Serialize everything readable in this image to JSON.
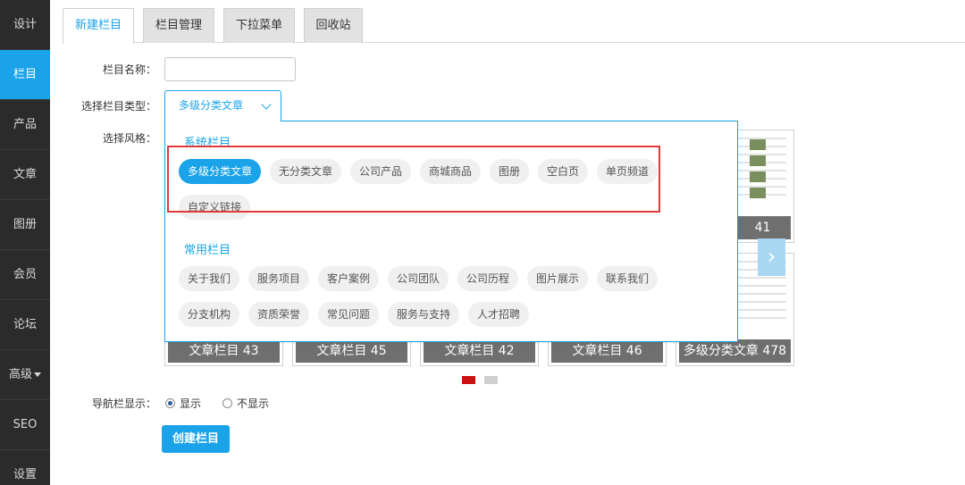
{
  "sidebar": {
    "items": [
      {
        "label": "设计"
      },
      {
        "label": "栏目"
      },
      {
        "label": "产品"
      },
      {
        "label": "文章"
      },
      {
        "label": "图册"
      },
      {
        "label": "会员"
      },
      {
        "label": "论坛"
      },
      {
        "label": "高级"
      },
      {
        "label": "SEO"
      },
      {
        "label": "设置"
      }
    ],
    "active_index": 1
  },
  "tabs": [
    {
      "label": "新建栏目"
    },
    {
      "label": "栏目管理"
    },
    {
      "label": "下拉菜单"
    },
    {
      "label": "回收站"
    }
  ],
  "form": {
    "name_label": "栏目名称：",
    "name_value": "",
    "type_label": "选择栏目类型：",
    "type_value": "多级分类文章",
    "style_label": "选择风格：",
    "nav_label": "导航栏显示：",
    "nav_options": [
      "显示",
      "不显示"
    ],
    "nav_selected": "显示",
    "create_button": "创建栏目"
  },
  "dropdown": {
    "system_title": "系统栏目",
    "system_items": [
      "多级分类文章",
      "无分类文章",
      "公司产品",
      "商城商品",
      "图册",
      "空白页",
      "单页频道",
      "自定义链接"
    ],
    "system_selected": "多级分类文章",
    "common_title": "常用栏目",
    "common_items": [
      "关于我们",
      "服务项目",
      "客户案例",
      "公司团队",
      "公司历程",
      "图片展示",
      "联系我们",
      "分支机构",
      "资质荣誉",
      "常见问题",
      "服务与支持",
      "人才招聘"
    ]
  },
  "styles": {
    "top_right_caption": "41",
    "captions": [
      "文章栏目 43",
      "文章栏目 45",
      "文章栏目 42",
      "文章栏目 46",
      "多级分类文章 478"
    ],
    "pages": 2,
    "current_page": 1
  },
  "colors": {
    "accent": "#1aa3e8",
    "sidebar_bg": "#2b2b2b",
    "highlight": "#e03a3a",
    "active_dot": "#cc1111"
  }
}
